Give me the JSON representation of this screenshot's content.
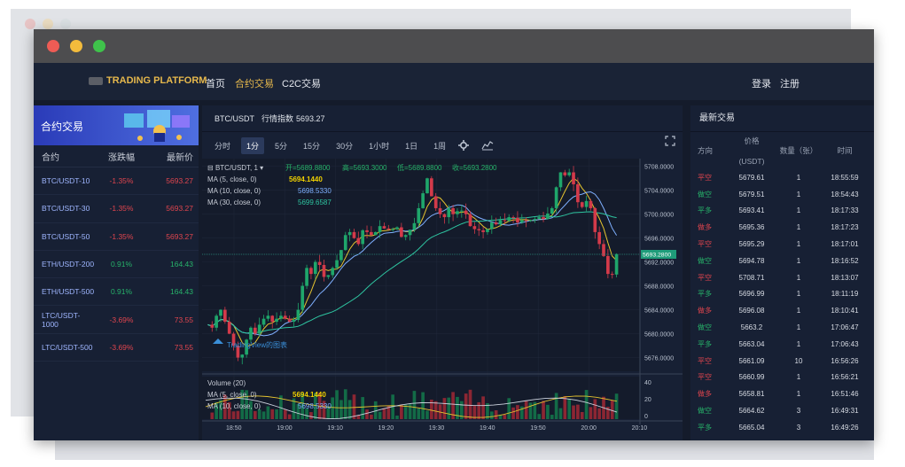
{
  "nav": {
    "logo": "TRADING PLATFORM",
    "links": [
      "首页",
      "合约交易",
      "C2C交易"
    ],
    "login": "登录",
    "register": "注册"
  },
  "left": {
    "banner_title": "合约交易",
    "headers": [
      "合约",
      "涨跌幅",
      "最新价"
    ],
    "rows": [
      {
        "pair": "BTC/USDT-10",
        "change": "-1.35%",
        "price": "5693.27"
      },
      {
        "pair": "BTC/USDT-30",
        "change": "-1.35%",
        "price": "5693.27"
      },
      {
        "pair": "BTC/USDT-50",
        "change": "-1.35%",
        "price": "5693.27"
      },
      {
        "pair": "ETH/USDT-200",
        "change": "0.91%",
        "price": "164.43"
      },
      {
        "pair": "ETH/USDT-500",
        "change": "0.91%",
        "price": "164.43"
      },
      {
        "pair": "LTC/USDT-1000",
        "change": "-3.69%",
        "price": "73.55"
      },
      {
        "pair": "LTC/USDT-500",
        "change": "-3.69%",
        "price": "73.55"
      }
    ]
  },
  "chart": {
    "symbol": "BTC/USDT",
    "index_label": "行情指数",
    "index_value": "5693.27",
    "intervals": [
      "分时",
      "1分",
      "5分",
      "15分",
      "30分",
      "1小时",
      "1日",
      "1周"
    ],
    "active_interval": "1分",
    "legend": {
      "line1_prefix": "BTC/USDT, 1",
      "open": "开=5689.8800",
      "high": "高=5693.3000",
      "low": "低=5689.8800",
      "close": "收=5693.2800",
      "ma5": "MA (5, close, 0)",
      "ma5_val": "5694.1440",
      "ma10": "MA (10, close, 0)",
      "ma10_val": "5698.5330",
      "ma30": "MA (30, close, 0)",
      "ma30_val": "5699.6587"
    },
    "vol_legend": {
      "volume": "Volume (20)",
      "ma5": "MA (5, close, 0)",
      "ma5_val": "5694.1440",
      "ma10": "MA (10, close, 0)",
      "ma10_val": "5698.5330"
    },
    "watermark": "TradingView的图表",
    "y_ticks": [
      "5708.0000",
      "5704.0000",
      "5700.0000",
      "5696.0000",
      "5692.0000",
      "5688.0000",
      "5684.0000",
      "5680.0000",
      "5676.0000"
    ],
    "last_price_tag": "5693.2800",
    "vol_ticks": [
      "40",
      "20",
      "0"
    ],
    "x_ticks": [
      "18:50",
      "19:00",
      "19:10",
      "19:20",
      "19:30",
      "19:40",
      "19:50",
      "20:00",
      "20:10"
    ]
  },
  "trades": {
    "title": "最新交易",
    "headers": {
      "dir": "方向",
      "price": "价格",
      "unit": "(USDT)",
      "qty": "数量（张）",
      "time": "时间"
    },
    "rows": [
      {
        "dir": "平空",
        "price": "5679.61",
        "qty": "1",
        "time": "18:55:59",
        "color": "#e0454e"
      },
      {
        "dir": "做空",
        "price": "5679.51",
        "qty": "1",
        "time": "18:54:43",
        "color": "#27b36a"
      },
      {
        "dir": "平多",
        "price": "5693.41",
        "qty": "1",
        "time": "18:17:33",
        "color": "#27b36a"
      },
      {
        "dir": "做多",
        "price": "5695.36",
        "qty": "1",
        "time": "18:17:23",
        "color": "#e0454e"
      },
      {
        "dir": "平空",
        "price": "5695.29",
        "qty": "1",
        "time": "18:17:01",
        "color": "#e0454e"
      },
      {
        "dir": "做空",
        "price": "5694.78",
        "qty": "1",
        "time": "18:16:52",
        "color": "#27b36a"
      },
      {
        "dir": "平空",
        "price": "5708.71",
        "qty": "1",
        "time": "18:13:07",
        "color": "#e0454e"
      },
      {
        "dir": "平多",
        "price": "5696.99",
        "qty": "1",
        "time": "18:11:19",
        "color": "#27b36a"
      },
      {
        "dir": "做多",
        "price": "5696.08",
        "qty": "1",
        "time": "18:10:41",
        "color": "#e0454e"
      },
      {
        "dir": "做空",
        "price": "5663.2",
        "qty": "1",
        "time": "17:06:47",
        "color": "#27b36a"
      },
      {
        "dir": "平多",
        "price": "5663.04",
        "qty": "1",
        "time": "17:06:43",
        "color": "#27b36a"
      },
      {
        "dir": "平空",
        "price": "5661.09",
        "qty": "10",
        "time": "16:56:26",
        "color": "#e0454e"
      },
      {
        "dir": "平空",
        "price": "5660.99",
        "qty": "1",
        "time": "16:56:21",
        "color": "#e0454e"
      },
      {
        "dir": "做多",
        "price": "5658.81",
        "qty": "1",
        "time": "16:51:46",
        "color": "#e0454e"
      },
      {
        "dir": "做空",
        "price": "5664.62",
        "qty": "3",
        "time": "16:49:31",
        "color": "#27b36a"
      },
      {
        "dir": "平多",
        "price": "5665.04",
        "qty": "3",
        "time": "16:49:26",
        "color": "#27b36a"
      }
    ]
  }
}
